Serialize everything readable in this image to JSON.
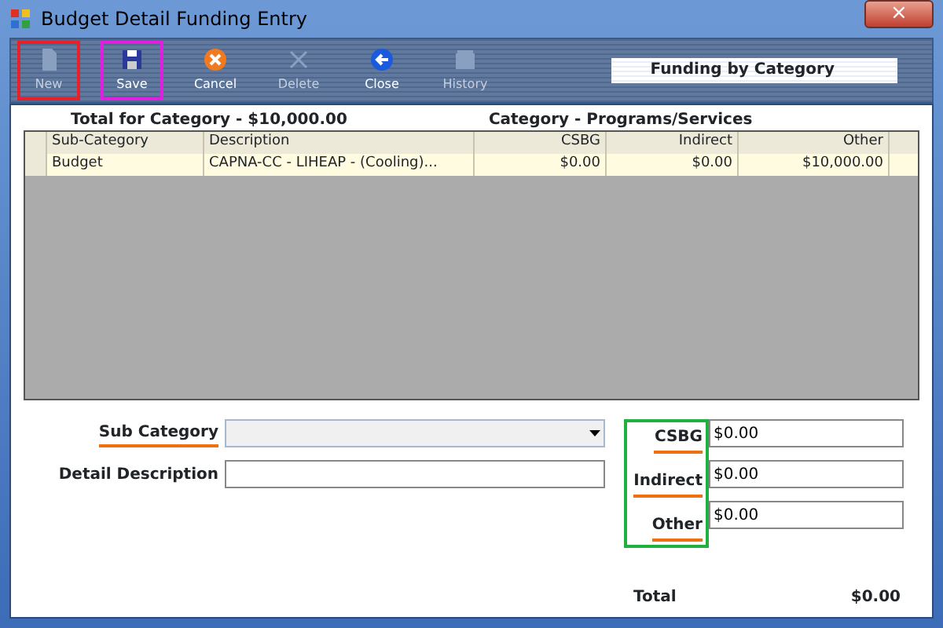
{
  "window": {
    "title": "Budget Detail Funding Entry",
    "close_label": "×"
  },
  "toolbar": {
    "buttons": [
      {
        "label": "New",
        "kind": "page",
        "disabled": true,
        "color": "#e8202a"
      },
      {
        "label": "Save",
        "kind": "disk",
        "disabled": false,
        "color": "#e020e0"
      },
      {
        "label": "Cancel",
        "kind": "cancel",
        "disabled": false
      },
      {
        "label": "Delete",
        "kind": "x",
        "disabled": true
      },
      {
        "label": "Close",
        "kind": "back",
        "disabled": false
      },
      {
        "label": "History",
        "kind": "stack",
        "disabled": true
      }
    ],
    "panel_title": "Funding by Category"
  },
  "total_for_category": "Total for Category - $10,000.00",
  "category": "Category - Programs/Services",
  "table": {
    "columns": [
      "Sub-Category",
      "Description",
      "CSBG",
      "Indirect",
      "Other"
    ],
    "rows": [
      {
        "cells": [
          "Budget",
          "CAPNA-CC - LIHEAP - (Cooling)...",
          "$0.00",
          "$0.00",
          "$10,000.00"
        ],
        "selected": true
      }
    ]
  },
  "form": {
    "sub_category": {
      "label": "Sub Category",
      "required": true
    },
    "detail_description": {
      "label": "Detail Description",
      "required": false
    }
  },
  "amounts": {
    "color": "#20b040",
    "fields": [
      {
        "label": "CSBG",
        "required": true,
        "value": "$0.00"
      },
      {
        "label": "Indirect",
        "required": true,
        "value": "$0.00"
      },
      {
        "label": "Other",
        "required": true,
        "value": "$0.00"
      }
    ],
    "total_label": "Total",
    "total_value": "$0.00"
  }
}
